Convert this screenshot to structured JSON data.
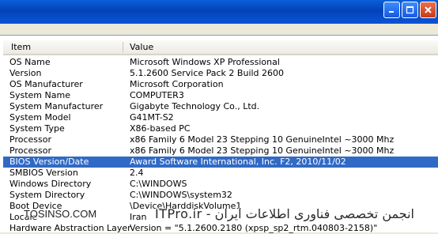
{
  "table": {
    "columns": [
      "Item",
      "Value"
    ],
    "rows": [
      {
        "item": "OS Name",
        "value": "Microsoft Windows XP Professional"
      },
      {
        "item": "Version",
        "value": "5.1.2600 Service Pack 2 Build 2600"
      },
      {
        "item": "OS Manufacturer",
        "value": "Microsoft Corporation"
      },
      {
        "item": "System Name",
        "value": "COMPUTER3"
      },
      {
        "item": "System Manufacturer",
        "value": "Gigabyte Technology Co., Ltd."
      },
      {
        "item": "System Model",
        "value": "G41MT-S2"
      },
      {
        "item": "System Type",
        "value": "X86-based PC"
      },
      {
        "item": "Processor",
        "value": "x86 Family 6 Model 23 Stepping 10 GenuineIntel ~3000 Mhz"
      },
      {
        "item": "Processor",
        "value": "x86 Family 6 Model 23 Stepping 10 GenuineIntel ~3000 Mhz"
      },
      {
        "item": "BIOS Version/Date",
        "value": "Award Software International, Inc. F2, 2010/11/02"
      },
      {
        "item": "SMBIOS Version",
        "value": "2.4"
      },
      {
        "item": "Windows Directory",
        "value": "C:\\WINDOWS"
      },
      {
        "item": "System Directory",
        "value": "C:\\WINDOWS\\system32"
      },
      {
        "item": "Boot Device",
        "value": "\\Device\\HarddiskVolume1"
      },
      {
        "item": "Locale",
        "value": "Iran"
      },
      {
        "item": "Hardware Abstraction Layer",
        "value": "Version = \"5.1.2600.2180 (xpsp_sp2_rtm.040803-2158)\""
      }
    ],
    "selected_index": 9
  },
  "watermark": {
    "left": "TOSINSO.COM",
    "right": "انجمن تخصصی فناوری اطلاعات ایران - ITPro.ir"
  },
  "colors": {
    "titlebar": "#0a5fd8",
    "selection": "#316ac5",
    "window_face": "#ece9d8"
  },
  "icons": [
    "minimize-icon",
    "maximize-icon",
    "close-icon"
  ]
}
